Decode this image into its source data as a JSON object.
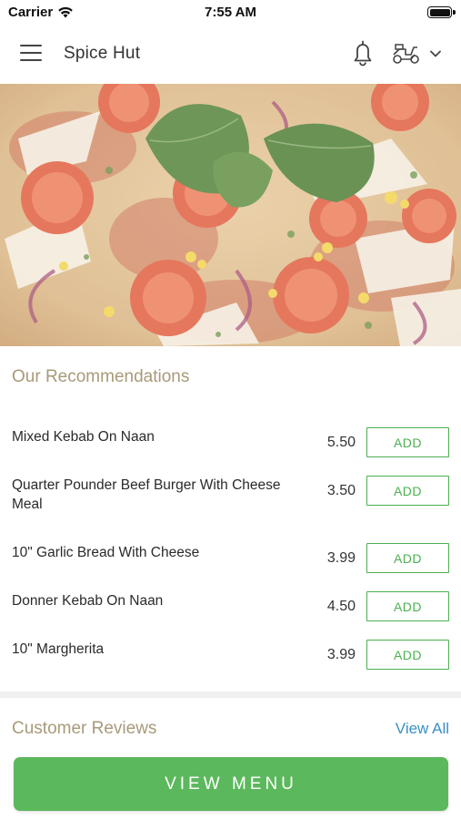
{
  "status_bar": {
    "carrier": "Carrier",
    "time": "7:55 AM"
  },
  "header": {
    "title": "Spice Hut",
    "icons": [
      "hamburger-menu-icon",
      "bell-icon",
      "scooter-icon",
      "chevron-down-icon"
    ]
  },
  "hero": {
    "image": "pizza-photo"
  },
  "recommendations": {
    "title": "Our Recommendations",
    "items": [
      {
        "name": "Mixed Kebab On Naan",
        "price": "5.50",
        "action": "ADD"
      },
      {
        "name": "Quarter Pounder Beef Burger With Cheese Meal",
        "price": "3.50",
        "action": "ADD"
      },
      {
        "name": "10\" Garlic Bread With Cheese",
        "price": "3.99",
        "action": "ADD"
      },
      {
        "name": "Donner Kebab On Naan",
        "price": "4.50",
        "action": "ADD"
      },
      {
        "name": "10\" Margherita",
        "price": "3.99",
        "action": "ADD"
      }
    ]
  },
  "reviews": {
    "title": "Customer Reviews",
    "view_all": "View All"
  },
  "footer": {
    "view_menu": "VIEW MENU"
  },
  "colors": {
    "accent_green": "#5cb85c",
    "section_title": "#a89a7a",
    "link_blue": "#3a8fc4"
  }
}
